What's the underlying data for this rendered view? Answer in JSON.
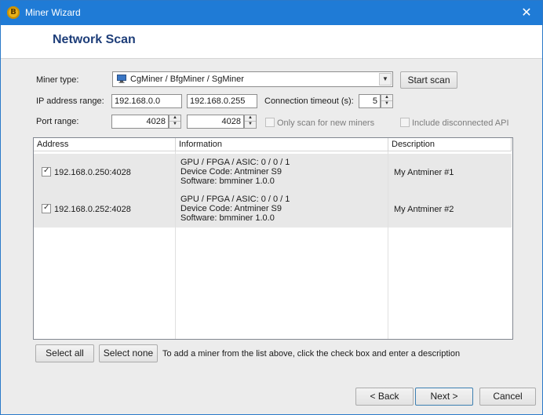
{
  "window": {
    "title": "Miner Wizard",
    "icon": "bitcoin-icon",
    "close_glyph": "✕"
  },
  "page_title": "Network Scan",
  "form": {
    "miner_type_label": "Miner type:",
    "miner_type_value": "CgMiner / BfgMiner / SgMiner",
    "start_scan_label": "Start scan",
    "ip_range_label": "IP address range:",
    "ip_start": "192.168.0.0",
    "ip_end": "192.168.0.255",
    "timeout_label": "Connection timeout (s):",
    "timeout_value": "5",
    "port_range_label": "Port range:",
    "port_start": "4028",
    "port_end": "4028",
    "only_new_label": "Only scan for new miners",
    "include_disconnected_label": "Include disconnected API"
  },
  "table": {
    "columns": [
      "Address",
      "Information",
      "Description"
    ],
    "rows": [
      {
        "checked": true,
        "address": "192.168.0.250:4028",
        "info": [
          "GPU / FPGA / ASIC: 0 / 0 / 1",
          "Device Code: Antminer S9",
          "Software: bmminer 1.0.0"
        ],
        "description": "My Antminer #1"
      },
      {
        "checked": true,
        "address": "192.168.0.252:4028",
        "info": [
          "GPU / FPGA / ASIC: 0 / 0 / 1",
          "Device Code: Antminer S9",
          "Software: bmminer 1.0.0"
        ],
        "description": "My Antminer #2"
      }
    ]
  },
  "select_all_label": "Select all",
  "select_none_label": "Select none",
  "hint_text": "To add a miner from the list above, click the check box and enter a description",
  "footer": {
    "back_label": "< Back",
    "next_label": "Next >",
    "cancel_label": "Cancel"
  },
  "colors": {
    "titlebar": "#1f7bd6",
    "heading": "#1e3e79",
    "row_bg": "#e8e8e8"
  }
}
